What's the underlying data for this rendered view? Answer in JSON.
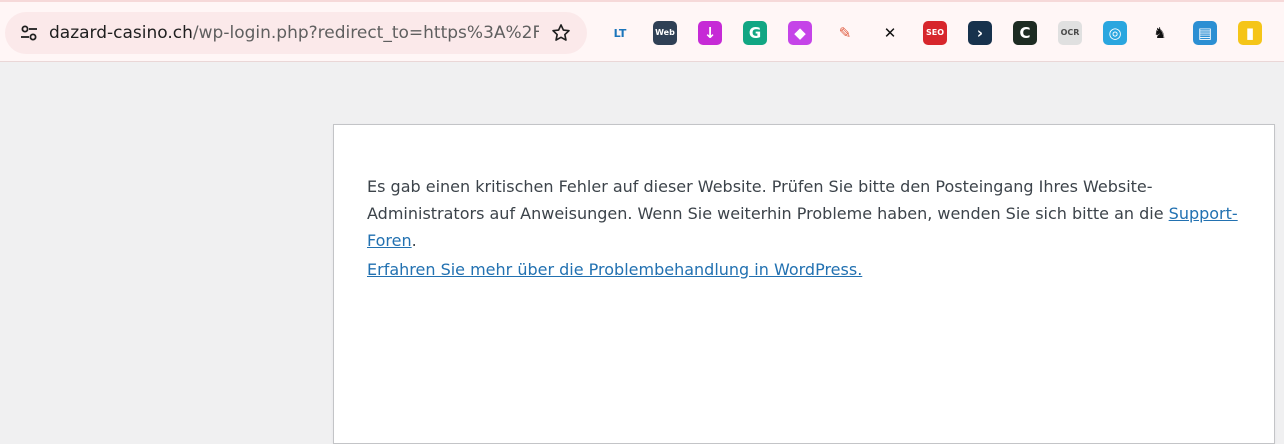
{
  "browser": {
    "url_host": "dazard-casino.ch",
    "url_path": "/wp-login.php?redirect_to=https%3A%2F%...",
    "site_info_icon": "tune-icon",
    "bookmark_icon": "star-outline-icon",
    "extensions": [
      {
        "name": "languagetool-extension-icon",
        "label": "LT",
        "color": "#1b75bb",
        "bg": "transparent"
      },
      {
        "name": "webhighlights-extension-icon",
        "label": "Web",
        "color": "#ffffff",
        "bg": "#2f4055"
      },
      {
        "name": "download-extension-icon",
        "label": "↓",
        "color": "#ffffff",
        "bg": "#c62ad6"
      },
      {
        "name": "grammarly-extension-icon",
        "label": "G",
        "color": "#ffffff",
        "bg": "#11a683"
      },
      {
        "name": "chat-extension-icon",
        "label": "◆",
        "color": "#ffffff",
        "bg": "#c544e8"
      },
      {
        "name": "color-picker-extension-icon",
        "label": "✎",
        "color": "#e05b3f",
        "bg": "transparent"
      },
      {
        "name": "ninja-extension-icon",
        "label": "✕",
        "color": "#111111",
        "bg": "transparent"
      },
      {
        "name": "seo-extension-icon",
        "label": "SEO",
        "color": "#ffffff",
        "bg": "#d7262c"
      },
      {
        "name": "hexagon-extension-icon",
        "label": "›",
        "color": "#ffffff",
        "bg": "#17324d"
      },
      {
        "name": "green-badge-extension-icon",
        "label": "C",
        "color": "#ffffff",
        "bg": "#1d2b22"
      },
      {
        "name": "ocr-extension-icon",
        "label": "OCR",
        "color": "#4a4a4a",
        "bg": "#e0e0e0"
      },
      {
        "name": "search-extension-icon",
        "label": "◎",
        "color": "#ffffff",
        "bg": "#2aa6df"
      },
      {
        "name": "person-extension-icon",
        "label": "♞",
        "color": "#111111",
        "bg": "transparent"
      },
      {
        "name": "reader-extension-icon",
        "label": "▤",
        "color": "#ffffff",
        "bg": "#2c8fd3"
      },
      {
        "name": "yellow-extension-icon",
        "label": "▮",
        "color": "#ffffff",
        "bg": "#f5c518"
      }
    ]
  },
  "page": {
    "error_text": "Es gab einen kritischen Fehler auf dieser Website. Prüfen Sie bitte den Posteingang Ihres Website-Administrators auf Anweisungen. Wenn Sie weiterhin Probleme haben, wenden Sie sich bitte an die ",
    "support_link": "Support-Foren",
    "error_text_end": ".",
    "learn_more_link": "Erfahren Sie mehr über die Problembehandlung in WordPress."
  }
}
